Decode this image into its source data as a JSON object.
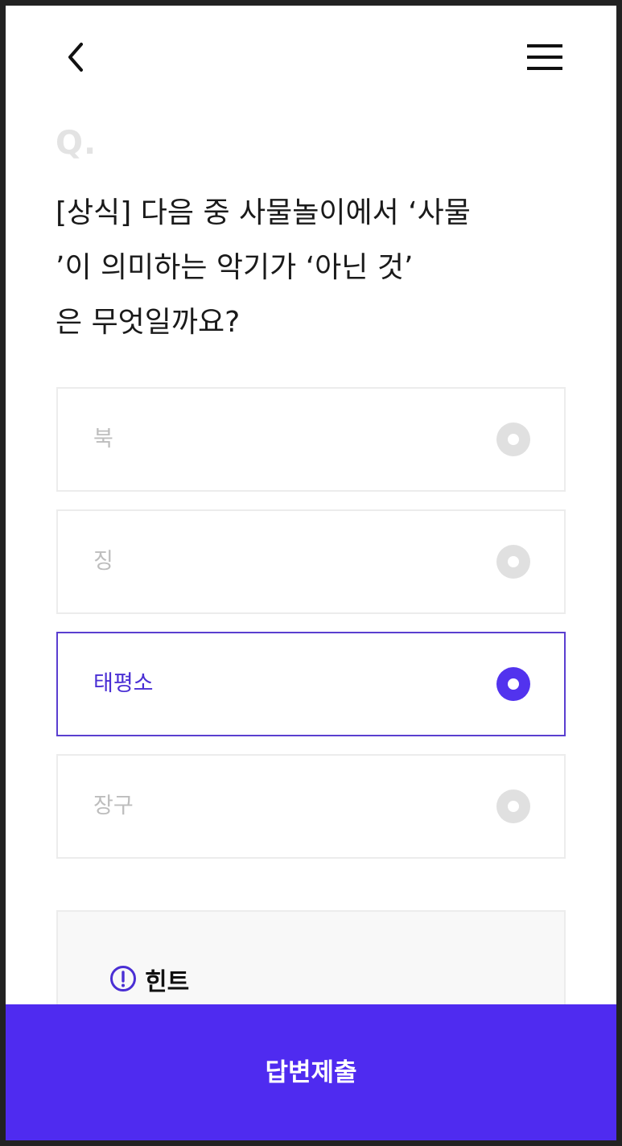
{
  "header": {
    "back_icon": "chevron-left-icon",
    "menu_icon": "hamburger-menu-icon"
  },
  "question": {
    "marker": "Q.",
    "text": "[상식] 다음 중 사물놀이에서 ‘사물\n’이 의미하는 악기가 ‘아닌 것’\n은 무엇일까요?"
  },
  "options": [
    {
      "label": "북",
      "selected": false
    },
    {
      "label": "징",
      "selected": false
    },
    {
      "label": "태평소",
      "selected": true
    },
    {
      "label": "장구",
      "selected": false
    }
  ],
  "hint": {
    "icon": "exclamation-circle-icon",
    "title": "힌트"
  },
  "submit": {
    "label": "답변제출"
  },
  "colors": {
    "accent": "#4f2bf0",
    "selected_border": "#5a3fd0",
    "unselected_radio": "#e0e0e0",
    "unselected_text": "#bdbdbd"
  }
}
